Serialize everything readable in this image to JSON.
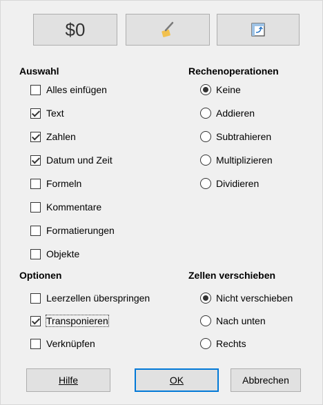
{
  "toolbar": {
    "values_only_label": "$0",
    "formats_only_icon": "broom-icon",
    "transpose_icon": "transpose-icon"
  },
  "auswahl": {
    "title": "Auswahl",
    "items": [
      {
        "label": "Alles einfügen",
        "checked": false
      },
      {
        "label": "Text",
        "checked": true
      },
      {
        "label": "Zahlen",
        "checked": true
      },
      {
        "label": "Datum und Zeit",
        "checked": true
      },
      {
        "label": "Formeln",
        "checked": false
      },
      {
        "label": "Kommentare",
        "checked": false
      },
      {
        "label": "Formatierungen",
        "checked": false
      },
      {
        "label": "Objekte",
        "checked": false
      }
    ]
  },
  "rechenoperationen": {
    "title": "Rechenoperationen",
    "options": [
      {
        "label": "Keine",
        "selected": true
      },
      {
        "label": "Addieren",
        "selected": false
      },
      {
        "label": "Subtrahieren",
        "selected": false
      },
      {
        "label": "Multiplizieren",
        "selected": false
      },
      {
        "label": "Dividieren",
        "selected": false
      }
    ]
  },
  "optionen": {
    "title": "Optionen",
    "items": [
      {
        "label": "Leerzellen überspringen",
        "checked": false
      },
      {
        "label": "Transponieren",
        "checked": true
      },
      {
        "label": "Verknüpfen",
        "checked": false
      }
    ]
  },
  "zellen": {
    "title": "Zellen verschieben",
    "options": [
      {
        "label": "Nicht verschieben",
        "selected": true
      },
      {
        "label": "Nach unten",
        "selected": false
      },
      {
        "label": "Rechts",
        "selected": false
      }
    ]
  },
  "buttons": {
    "help": "Hilfe",
    "ok": "OK",
    "cancel": "Abbrechen"
  }
}
